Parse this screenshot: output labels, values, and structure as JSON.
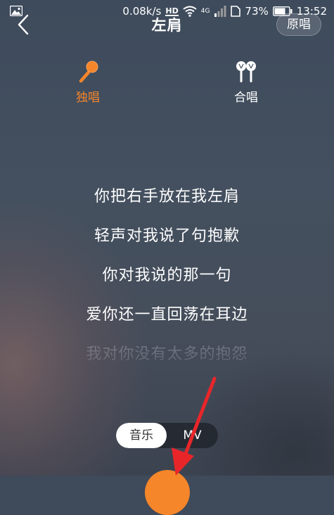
{
  "status_bar": {
    "speed": "0.08k/s",
    "hd": "HD",
    "network": "4G",
    "battery": "73%",
    "time": "13:52"
  },
  "header": {
    "title": "左肩",
    "original_label": "原唱"
  },
  "modes": [
    {
      "label": "独唱",
      "icon": "microphone-icon",
      "active": true
    },
    {
      "label": "合唱",
      "icon": "duet-microphones-icon",
      "active": false
    }
  ],
  "lyrics": [
    "你把右手放在我左肩",
    "轻声对我说了句抱歉",
    "你对我说的那一句",
    "爱你还一直回荡在耳边",
    "我对你没有太多的抱怨"
  ],
  "media_toggle": {
    "music_label": "音乐",
    "mv_label": "MV",
    "selected": "音乐"
  },
  "colors": {
    "accent": "#f5862a",
    "annotation": "#e8262a"
  }
}
